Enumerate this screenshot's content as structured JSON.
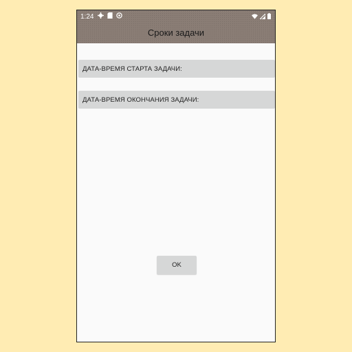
{
  "status_bar": {
    "time": "1:24"
  },
  "app_bar": {
    "title": "Сроки задачи"
  },
  "form": {
    "start_label": "ДАТА-ВРЕМЯ СТАРТА ЗАДАЧИ:",
    "end_label": "ДАТА-ВРЕМЯ ОКОНЧАНИЯ ЗАДАЧИ:"
  },
  "actions": {
    "ok_label": "OK"
  },
  "colors": {
    "page_background": "#ffecb3",
    "app_bar": "#8a7d75",
    "field_background": "#d6d7d7",
    "screen_background": "#fafafa"
  }
}
